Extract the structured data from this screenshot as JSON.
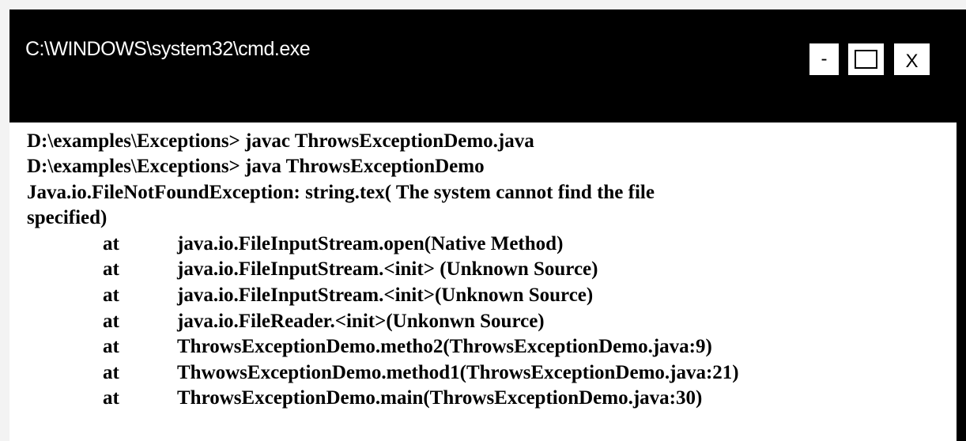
{
  "window": {
    "title": "C:\\WINDOWS\\system32\\cmd.exe",
    "minimize_label": "-",
    "close_label": "X"
  },
  "console": {
    "lines": [
      "D:\\examples\\Exceptions> javac ThrowsExceptionDemo.java",
      "D:\\examples\\Exceptions> java ThrowsExceptionDemo",
      "Java.io.FileNotFoundException: string.tex( The system cannot find the file",
      "specified)"
    ],
    "stack_trace": [
      {
        "at": "at",
        "frame": "java.io.FileInputStream.open(Native Method)"
      },
      {
        "at": "at",
        "frame": "java.io.FileInputStream.<init> (Unknown Source)"
      },
      {
        "at": "at",
        "frame": "java.io.FileInputStream.<init>(Unknown Source)"
      },
      {
        "at": "at",
        "frame": "java.io.FileReader.<init>(Unkonwn Source)"
      },
      {
        "at": "at",
        "frame": "ThrowsExceptionDemo.metho2(ThrowsExceptionDemo.java:9)"
      },
      {
        "at": "at",
        "frame": "ThwowsExceptionDemo.method1(ThrowsExceptionDemo.java:21)"
      },
      {
        "at": "at",
        "frame": "ThrowsExceptionDemo.main(ThrowsExceptionDemo.java:30)"
      }
    ]
  },
  "colors": {
    "titlebar_bg": "#000000",
    "title_text": "#ffffff",
    "console_bg": "#ffffff",
    "console_text": "#000000"
  }
}
